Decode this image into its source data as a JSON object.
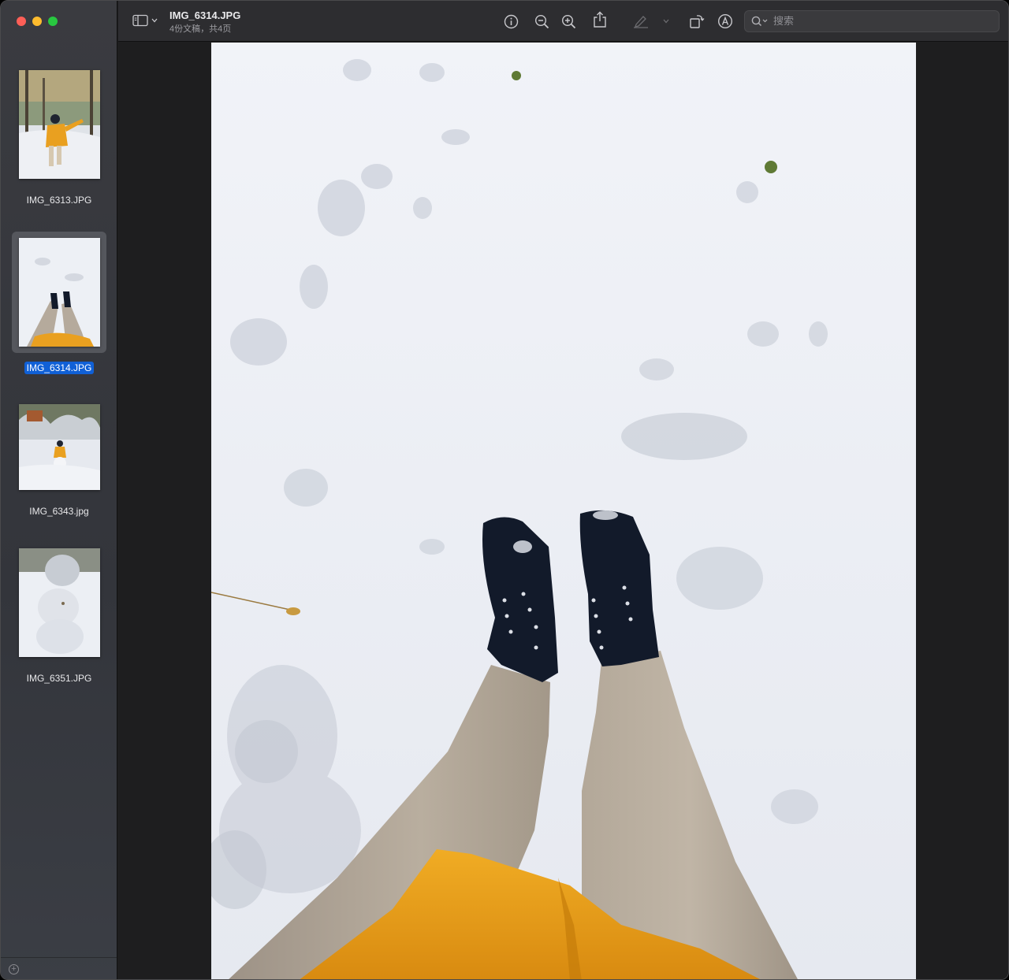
{
  "window": {
    "controls": [
      "close",
      "minimize",
      "zoom"
    ]
  },
  "toolbar": {
    "title": "IMG_6314.JPG",
    "subtitle": "4份文稿，共4页",
    "icons": [
      "sidebar-icon",
      "info-icon",
      "zoom-out-icon",
      "zoom-in-icon",
      "share-icon",
      "highlight-icon",
      "rotate-icon",
      "markup-icon"
    ],
    "search_placeholder": "搜索"
  },
  "sidebar": {
    "items": [
      {
        "label": "IMG_6313.JPG",
        "selected": false
      },
      {
        "label": "IMG_6314.JPG",
        "selected": true
      },
      {
        "label": "IMG_6343.jpg",
        "selected": false
      },
      {
        "label": "IMG_6351.JPG",
        "selected": false
      }
    ]
  },
  "colors": {
    "accent": "#1060d6",
    "jacket": "#e9a020",
    "boots": "#121a2a",
    "pants": "#b5aa9c",
    "snow": "#eef0f6"
  }
}
